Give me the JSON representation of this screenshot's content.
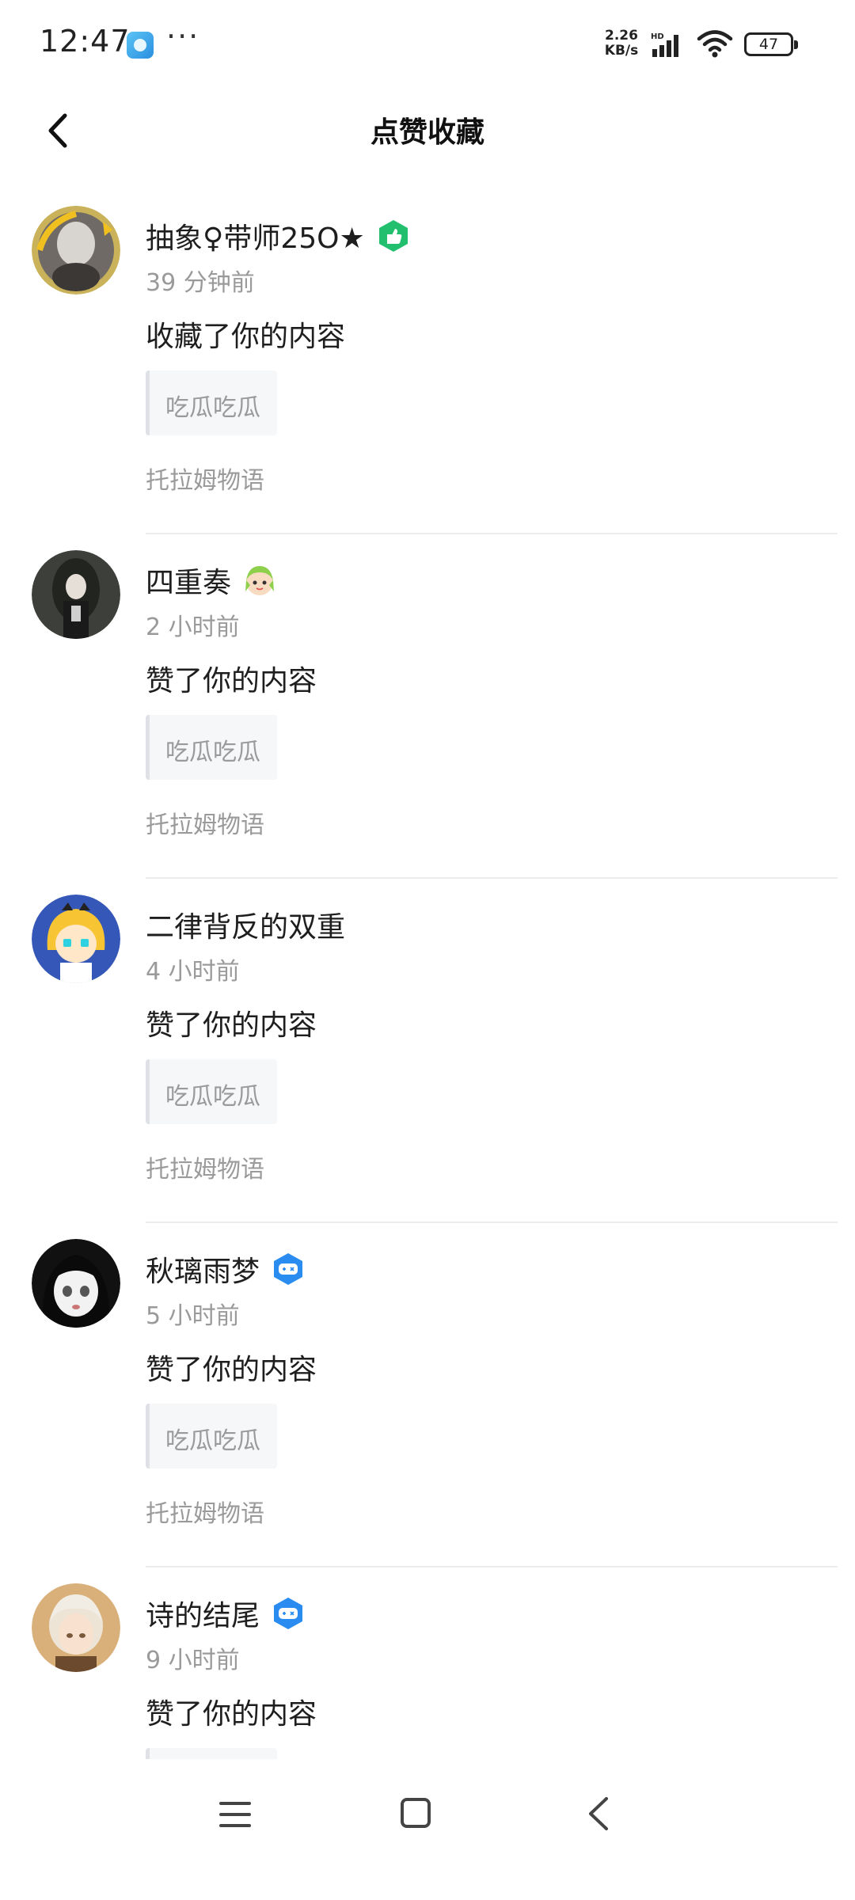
{
  "status_bar": {
    "time": "12:47",
    "dots": "···",
    "speed_value": "2.26",
    "speed_unit": "KB/s",
    "hd": "HD",
    "battery": "47"
  },
  "header": {
    "title": "点赞收藏",
    "back_icon": "chevron-left-icon"
  },
  "notifications": [
    {
      "name": "抽象♀带师25O★",
      "badge": "green-hand-badge",
      "time": "39 分钟前",
      "action": "收藏了你的内容",
      "quote": "吃瓜吃瓜",
      "source": "托拉姆物语"
    },
    {
      "name": "四重奏",
      "badge": "anime-emoji-badge",
      "time": "2 小时前",
      "action": "赞了你的内容",
      "quote": "吃瓜吃瓜",
      "source": "托拉姆物语"
    },
    {
      "name": "二律背反的双重",
      "badge": "",
      "time": "4 小时前",
      "action": "赞了你的内容",
      "quote": "吃瓜吃瓜",
      "source": "托拉姆物语"
    },
    {
      "name": "秋璃雨梦",
      "badge": "gamepad-badge",
      "time": "5 小时前",
      "action": "赞了你的内容",
      "quote": "吃瓜吃瓜",
      "source": "托拉姆物语"
    },
    {
      "name": "诗的结尾",
      "badge": "gamepad-badge",
      "time": "9 小时前",
      "action": "赞了你的内容",
      "quote": "",
      "source": ""
    }
  ],
  "colors": {
    "green_badge": "#22c06e",
    "blue_badge": "#2a8cf0",
    "secondary_text": "#9a9a9a",
    "quote_bg": "#f6f7f9"
  },
  "nav_bar": {
    "icons": [
      "menu-icon",
      "home-square-icon",
      "back-triangle-icon"
    ]
  }
}
